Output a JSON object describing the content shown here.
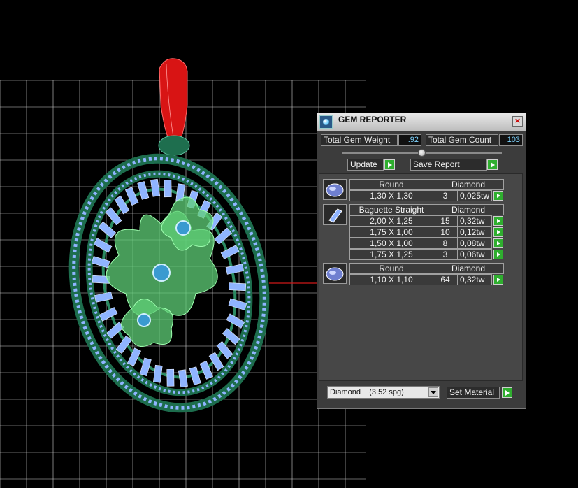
{
  "panel": {
    "title": "GEM REPORTER",
    "close_icon": "close-icon",
    "total_weight_label": "Total Gem Weight",
    "total_weight_value": ".92",
    "total_count_label": "Total Gem Count",
    "total_count_value": "103",
    "update_label": "Update",
    "save_report_label": "Save Report",
    "groups": [
      {
        "icon": "round-gem-icon",
        "shape": "Round",
        "material": "Diamond",
        "rows": [
          {
            "size": "1,30 X 1,30",
            "count": "3",
            "weight": "0,025tw"
          }
        ]
      },
      {
        "icon": "baguette-gem-icon",
        "shape": "Baguette Straight",
        "material": "Diamond",
        "rows": [
          {
            "size": "2,00 X 1,25",
            "count": "15",
            "weight": "0,32tw"
          },
          {
            "size": "1,75 X 1,00",
            "count": "10",
            "weight": "0,12tw"
          },
          {
            "size": "1,50 X 1,00",
            "count": "8",
            "weight": "0,08tw"
          },
          {
            "size": "1,75 X 1,25",
            "count": "3",
            "weight": "0,06tw"
          }
        ]
      },
      {
        "icon": "round-gem-icon",
        "shape": "Round",
        "material": "Diamond",
        "rows": [
          {
            "size": "1,10 X 1,10",
            "count": "64",
            "weight": "0,32tw"
          }
        ]
      }
    ],
    "material_select_value": "Diamond    (3,52 spg)",
    "set_material_label": "Set Material"
  },
  "colors": {
    "panel_bg": "#3c3c3c",
    "accent_green": "#2fae2f",
    "value_cyan": "#7fd4ff",
    "grid_line": "#cfcfcf",
    "gem_blue": "#8fb4ff",
    "metal_green": "#1f6e4e",
    "bail_red": "#e01010"
  }
}
